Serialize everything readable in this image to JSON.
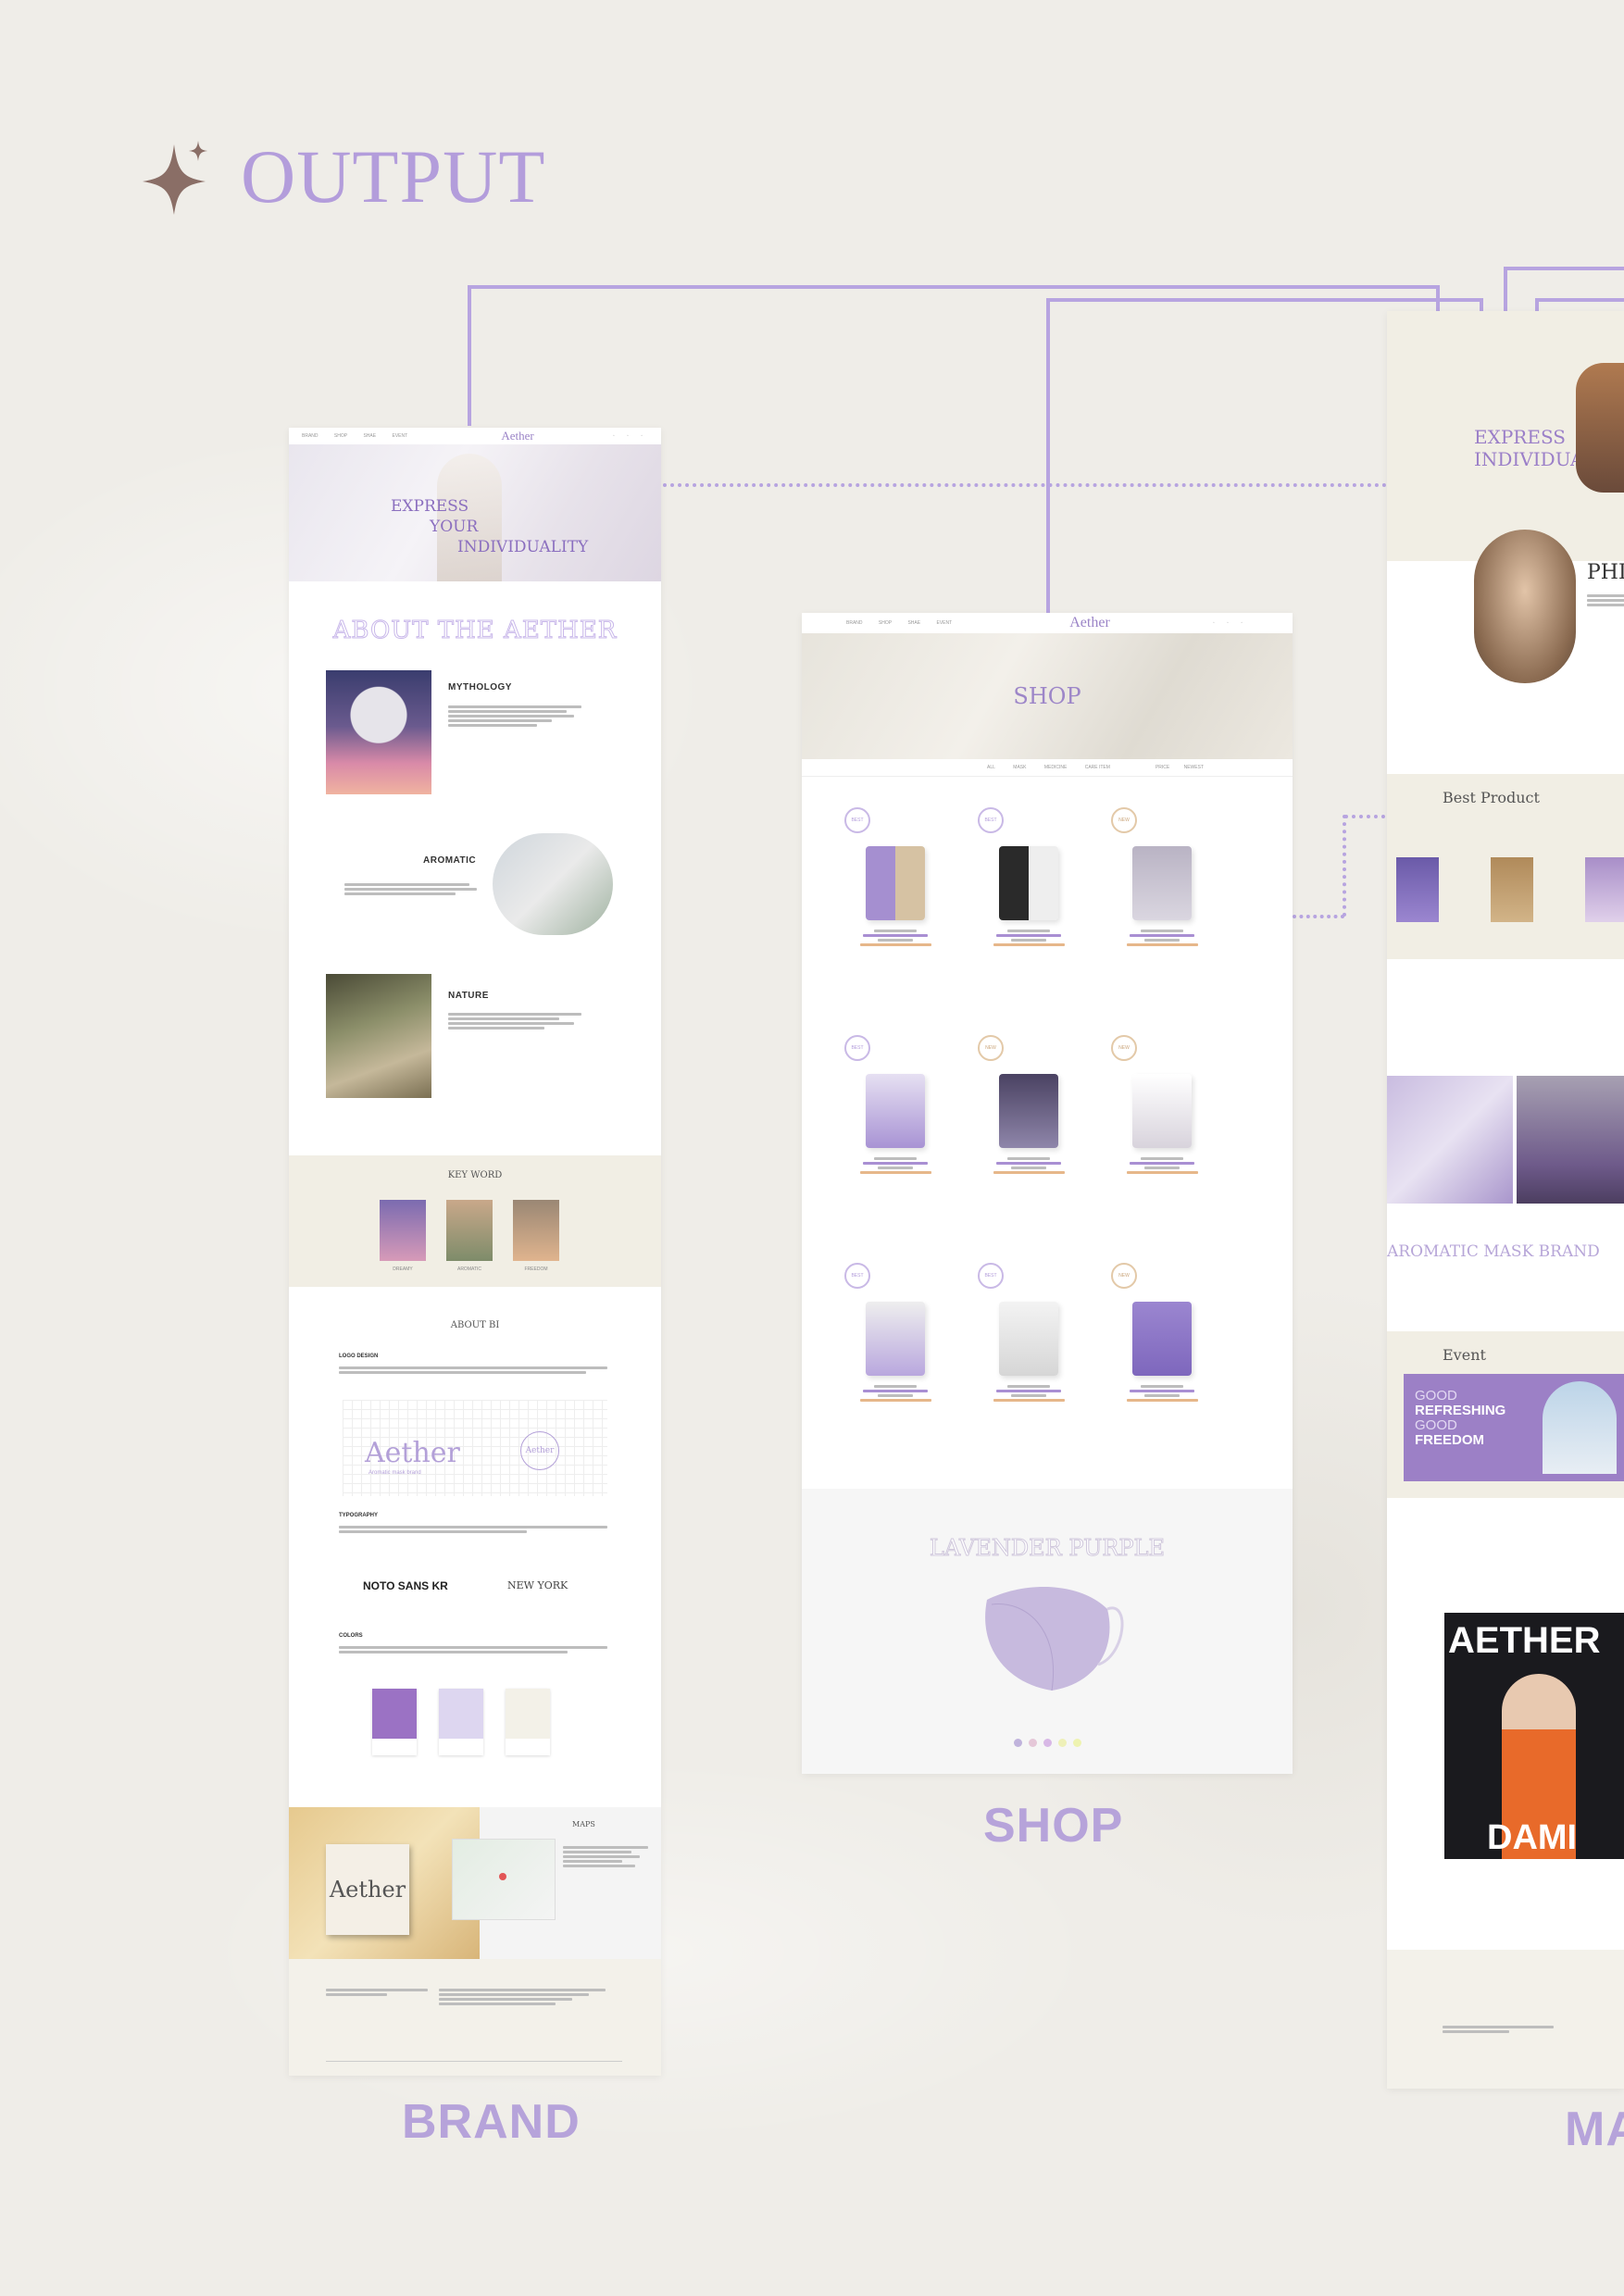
{
  "heading": {
    "title": "OUTPUT",
    "icon": "sparkle-icon"
  },
  "captions": {
    "brand": "BRAND",
    "shop": "SHOP",
    "main": "MA"
  },
  "brand_page": {
    "nav": {
      "links": [
        "BRAND",
        "SHOP",
        "SHAE",
        "EVENT"
      ],
      "logo": "Aether"
    },
    "hero": {
      "line1": "EXPRESS",
      "line2": "YOUR",
      "line3": "INDIVIDUALITY"
    },
    "about_title": "ABOUT THE AETHER",
    "sections": [
      {
        "title": "MYTHOLOGY"
      },
      {
        "title": "AROMATIC"
      },
      {
        "title": "NATURE"
      }
    ],
    "keyword": {
      "title": "KEY WORD",
      "items": [
        "DREAMY",
        "AROMATIC",
        "FREEDOM"
      ]
    },
    "about_bi": {
      "title": "ABOUT BI",
      "logo_design": "LOGO DESIGN",
      "logo_main": "Aether",
      "logo_sub": "Aromatic mask brand",
      "logo_emblem": "Aether",
      "typography": "TYPOGRAPHY",
      "font1": "NOTO SANS KR",
      "font2": "NEW YORK",
      "colors": "COLORS",
      "swatches": [
        {
          "color": "#9b72c4"
        },
        {
          "color": "#ddd6f0"
        },
        {
          "color": "#f3f1e8"
        }
      ]
    },
    "maps": {
      "title": "MAPS",
      "sign": "Aether"
    }
  },
  "shop_page": {
    "nav": {
      "links": [
        "BRAND",
        "SHOP",
        "SHAE",
        "EVENT"
      ],
      "logo": "Aether"
    },
    "hero_title": "SHOP",
    "filters": [
      "ALL",
      "MASK",
      "MEDICINE",
      "CARE ITEM"
    ],
    "sort": [
      "PRICE",
      "NEWEST"
    ],
    "products": [
      {
        "badge": "BEST",
        "type": "mask-pack"
      },
      {
        "badge": "BEST",
        "type": "mask-black"
      },
      {
        "badge": "NEW",
        "type": "mask-single"
      },
      {
        "badge": "BEST",
        "type": "bottle"
      },
      {
        "badge": "NEW",
        "type": "pouch"
      },
      {
        "badge": "NEW",
        "type": "serum"
      },
      {
        "badge": "BEST",
        "type": "pump"
      },
      {
        "badge": "BEST",
        "type": "bag"
      },
      {
        "badge": "NEW",
        "type": "sachet"
      }
    ],
    "feature": {
      "title": "LAVENDER PURPLE",
      "colors": [
        "#c0b3dc",
        "#e5c7d8",
        "#d8b8e6",
        "#eef0b8",
        "#eef3b0"
      ]
    }
  },
  "main_page": {
    "hero": {
      "line1": "EXPRESS",
      "line2": "INDIVIDUALI"
    },
    "phi": "PHI",
    "best_product": "Best Product",
    "brand_banner": "AROMATIC MASK BRAND",
    "event": {
      "title": "Event",
      "line1": "GOOD",
      "line2": "REFRESHING",
      "line3": "GOOD",
      "line4": "FREEDOM"
    },
    "poster": {
      "title": "AETHER",
      "name": "DAMI"
    }
  }
}
